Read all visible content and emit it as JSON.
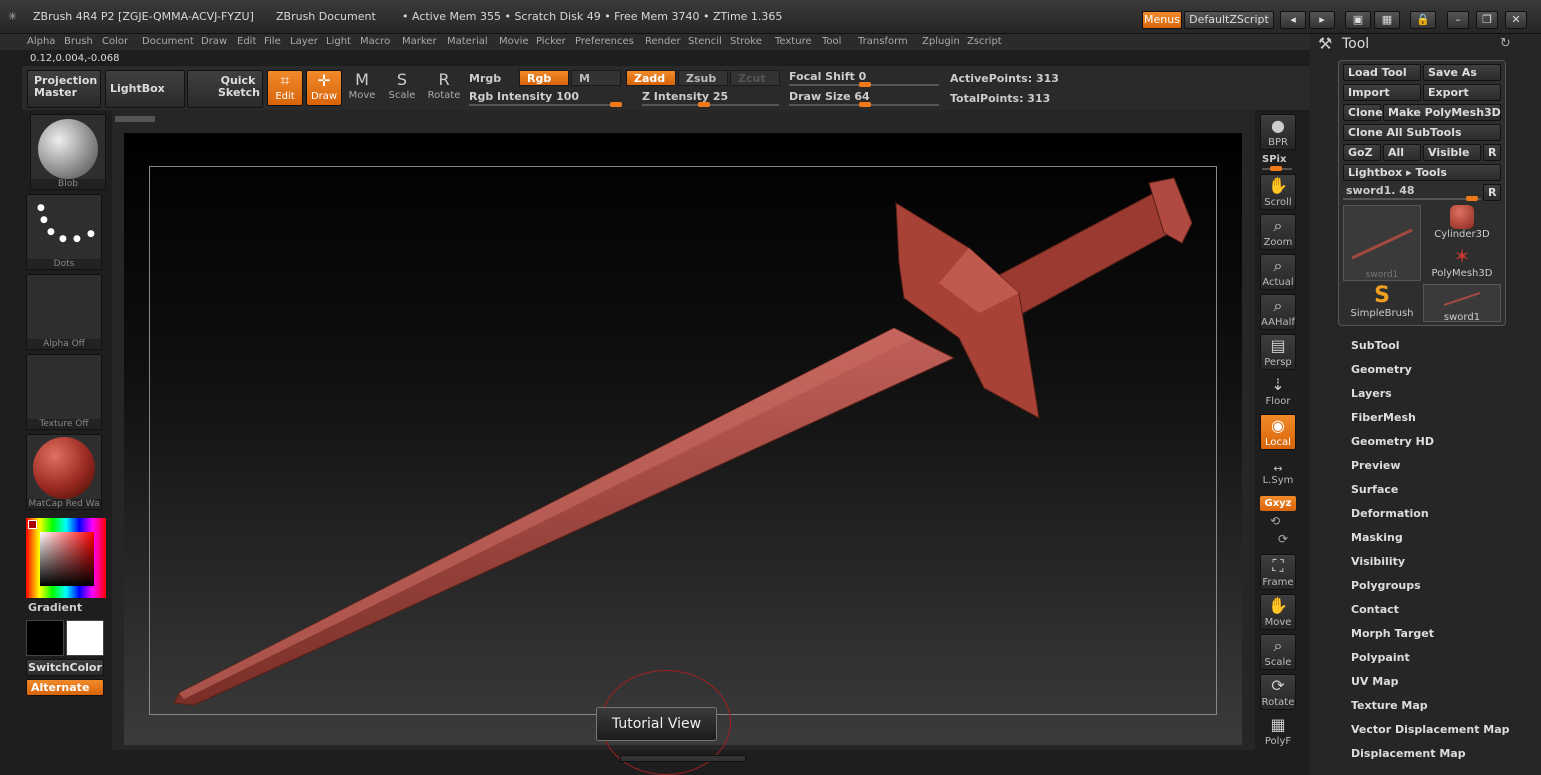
{
  "title": {
    "app": "ZBrush 4R4 P2 [ZGJE-QMMA-ACVJ-FYZU]",
    "doc": "ZBrush Document",
    "mem": "• Active Mem 355 • Scratch Disk 49 • Free Mem 3740 • ZTime 1.365"
  },
  "titlebar": {
    "menus": "Menus",
    "script": "DefaultZScript"
  },
  "menu": [
    "Alpha",
    "Brush",
    "Color",
    "Document",
    "Draw",
    "Edit",
    "File",
    "Layer",
    "Light",
    "Macro",
    "Marker",
    "Material",
    "Movie",
    "Picker",
    "Preferences",
    "Render",
    "Stencil",
    "Stroke",
    "Texture",
    "Tool",
    "Transform",
    "Zplugin",
    "Zscript"
  ],
  "coords": "0.12,0.004,-0.068",
  "toolbar": {
    "projection": "Projection\nMaster",
    "lightbox": "LightBox",
    "quick": "Quick\nSketch",
    "edit": "Edit",
    "draw": "Draw",
    "move": "Move",
    "scale": "Scale",
    "rotate": "Rotate",
    "mrgb": "Mrgb",
    "rgb": "Rgb",
    "m": "M",
    "zadd": "Zadd",
    "zsub": "Zsub",
    "zcut": "Zcut",
    "rgb_int": "Rgb Intensity 100",
    "z_int": "Z Intensity 25",
    "focal": "Focal Shift 0",
    "draw_size": "Draw Size 64",
    "active_pts": "ActivePoints: 313",
    "total_pts": "TotalPoints: 313"
  },
  "left": {
    "blob": "Blob",
    "dots": "Dots",
    "alpha": "Alpha Off",
    "texture": "Texture Off",
    "matcap": "MatCap Red Wa",
    "gradient": "Gradient",
    "switch": "SwitchColor",
    "alternate": "Alternate"
  },
  "right": [
    "BPR",
    "SPix",
    "Scroll",
    "Zoom",
    "Actual",
    "AAHalf",
    "Persp",
    "Floor",
    "Local",
    "L.Sym",
    "Gxyz",
    "Frame",
    "Move",
    "Scale",
    "Rotate",
    "PolyF"
  ],
  "tool": {
    "header": "Tool",
    "load": "Load Tool",
    "saveas": "Save As",
    "import": "Import",
    "export": "Export",
    "clone": "Clone",
    "makepm": "Make PolyMesh3D",
    "cloneall": "Clone All SubTools",
    "goz": "GoZ",
    "all": "All",
    "visible": "Visible",
    "r": "R",
    "lightbox": "Lightbox ▸ Tools",
    "current": "sword1. 48",
    "thumbs": [
      "sword1",
      "Cylinder3D",
      "PolyMesh3D",
      "SimpleBrush",
      "sword1"
    ],
    "sections": [
      "SubTool",
      "Geometry",
      "Layers",
      "FiberMesh",
      "Geometry HD",
      "Preview",
      "Surface",
      "Deformation",
      "Masking",
      "Visibility",
      "Polygroups",
      "Contact",
      "Morph Target",
      "Polypaint",
      "UV Map",
      "Texture Map",
      "Vector Displacement Map",
      "Displacement Map"
    ]
  },
  "tutorial": "Tutorial View",
  "colors": {
    "accent": "#f07a1a",
    "sword": "#a34a40"
  }
}
